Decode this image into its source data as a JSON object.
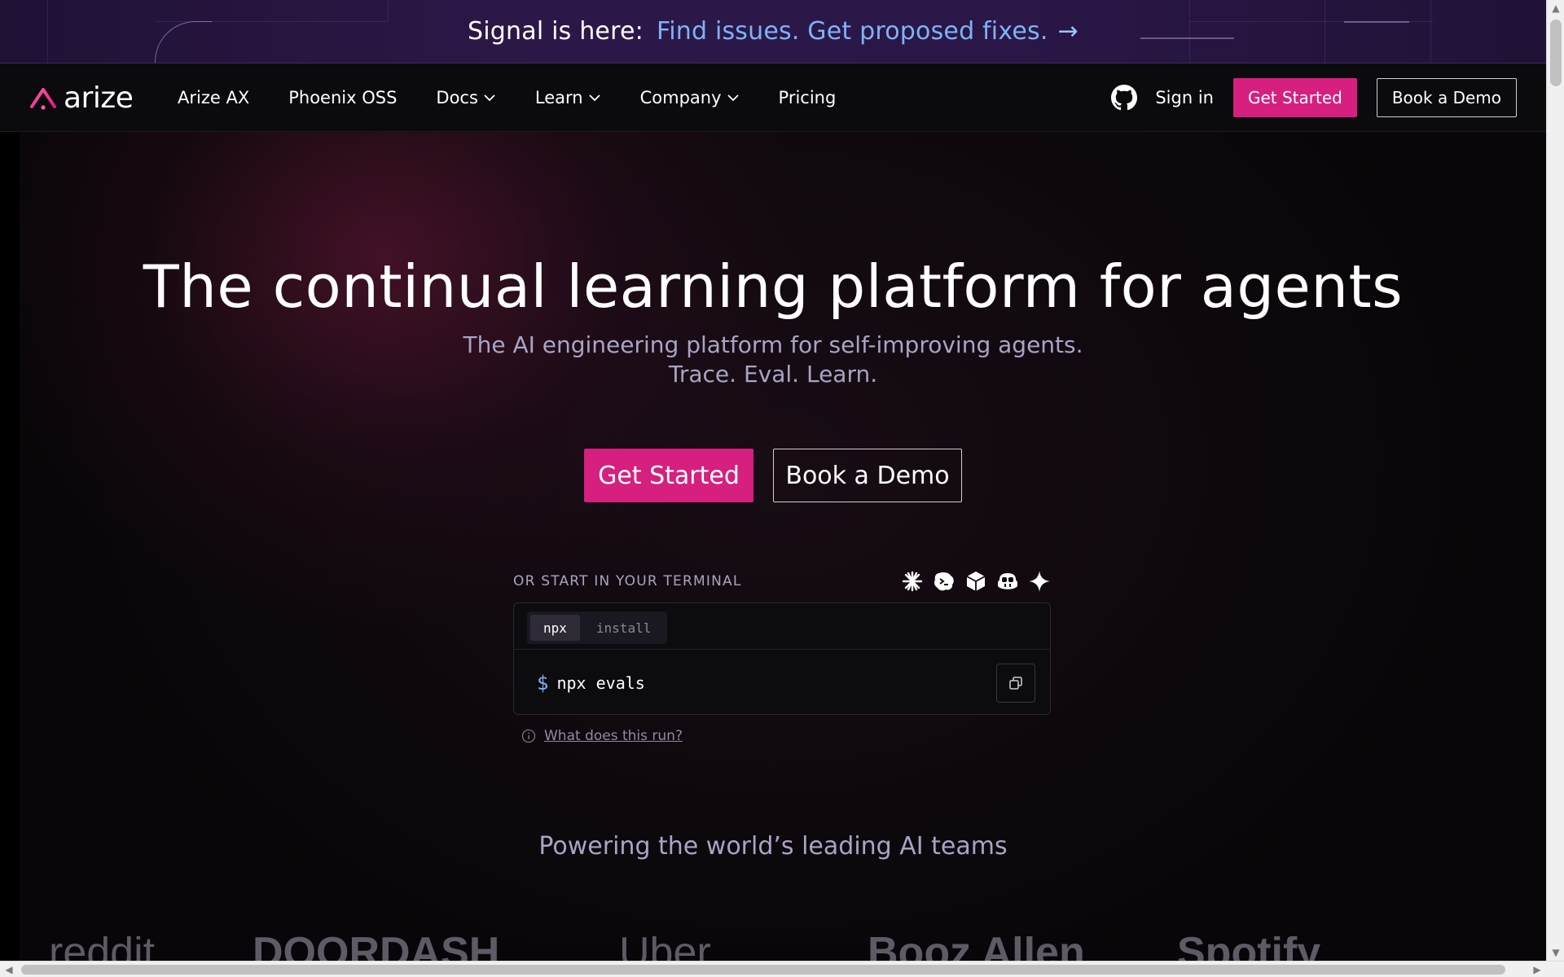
{
  "banner": {
    "lead": "Signal is here:",
    "link": "Find issues. Get proposed fixes.",
    "arrow": "→"
  },
  "nav": {
    "logo_text": "arize",
    "links": [
      {
        "label": "Arize AX",
        "dropdown": false
      },
      {
        "label": "Phoenix OSS",
        "dropdown": false
      },
      {
        "label": "Docs",
        "dropdown": true
      },
      {
        "label": "Learn",
        "dropdown": true
      },
      {
        "label": "Company",
        "dropdown": true
      },
      {
        "label": "Pricing",
        "dropdown": false
      }
    ],
    "sign_in": "Sign in",
    "get_started": "Get Started",
    "book_demo": "Book a Demo"
  },
  "hero": {
    "title": "The continual learning platform for agents",
    "subtitle_line1": "The AI engineering platform for self-improving agents.",
    "subtitle_line2": "Trace. Eval. Learn.",
    "cta_primary": "Get Started",
    "cta_secondary": "Book a Demo"
  },
  "terminal": {
    "label": "OR START IN YOUR TERMINAL",
    "tabs": [
      {
        "label": "npx",
        "active": true
      },
      {
        "label": "install",
        "active": false
      }
    ],
    "prompt": "$",
    "command": "npx evals",
    "help_link": "What does this run?",
    "agent_icons": [
      "claude-icon",
      "terminal-agent-icon",
      "cube-icon",
      "copilot-icon",
      "gemini-sparkle-icon"
    ]
  },
  "powering": "Powering the world’s leading AI teams",
  "customer_logos": [
    "reddit",
    "DOORDASH",
    "Uber",
    "Booz Allen",
    "Spotify"
  ],
  "colors": {
    "accent_pink": "#d61f7f",
    "banner_link": "#7fb2f7",
    "background": "#080608",
    "muted_text": "#a8a4c4"
  }
}
